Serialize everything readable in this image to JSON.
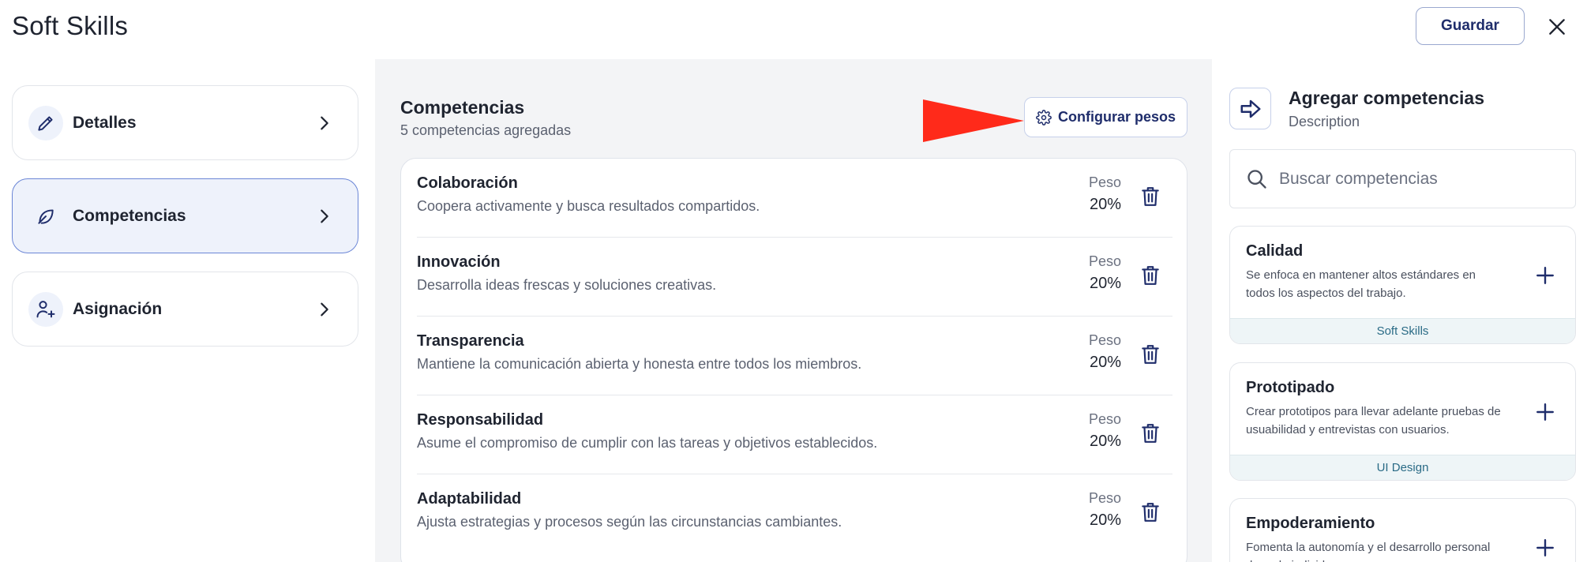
{
  "header": {
    "title": "Soft Skills",
    "save_label": "Guardar"
  },
  "nav": {
    "items": [
      {
        "label": "Detalles",
        "icon": "pencil-icon",
        "active": false
      },
      {
        "label": "Competencias",
        "icon": "leaf-icon",
        "active": true
      },
      {
        "label": "Asignación",
        "icon": "user-plus-icon",
        "active": false
      }
    ]
  },
  "competencias": {
    "title": "Competencias",
    "subtitle": "5 competencias agregadas",
    "config_label": "Configurar pesos",
    "peso_label": "Peso",
    "items": [
      {
        "name": "Colaboración",
        "desc": "Coopera activamente y busca resultados compartidos.",
        "peso": "20%"
      },
      {
        "name": "Innovación",
        "desc": "Desarrolla ideas frescas y soluciones creativas.",
        "peso": "20%"
      },
      {
        "name": "Transparencia",
        "desc": "Mantiene la comunicación abierta y honesta entre todos los miembros.",
        "peso": "20%"
      },
      {
        "name": "Responsabilidad",
        "desc": "Asume el compromiso de cumplir con las tareas y objetivos establecidos.",
        "peso": "20%"
      },
      {
        "name": "Adaptabilidad",
        "desc": "Ajusta estrategias y procesos según las circunstancias cambiantes.",
        "peso": "20%"
      }
    ]
  },
  "agregar": {
    "title": "Agregar competencias",
    "subtitle": "Description",
    "search_placeholder": "Buscar competencias",
    "suggestions": [
      {
        "name": "Calidad",
        "desc": "Se enfoca en mantener altos estándares en todos los aspectos del trabajo.",
        "tag": "Soft Skills"
      },
      {
        "name": "Prototipado",
        "desc": "Crear prototipos para llevar adelante pruebas de usuabilidad y entrevistas con usuarios.",
        "tag": "UI Design"
      },
      {
        "name": "Empoderamiento",
        "desc": "Fomenta la autonomía y el desarrollo personal de cada individuo.",
        "tag": ""
      }
    ]
  },
  "colors": {
    "accent": "#1f2d6b",
    "active_bg": "#eef2fb",
    "active_border": "#6b86d6",
    "panel_bg": "#f3f4f6",
    "pointer": "#ff2a1a"
  }
}
